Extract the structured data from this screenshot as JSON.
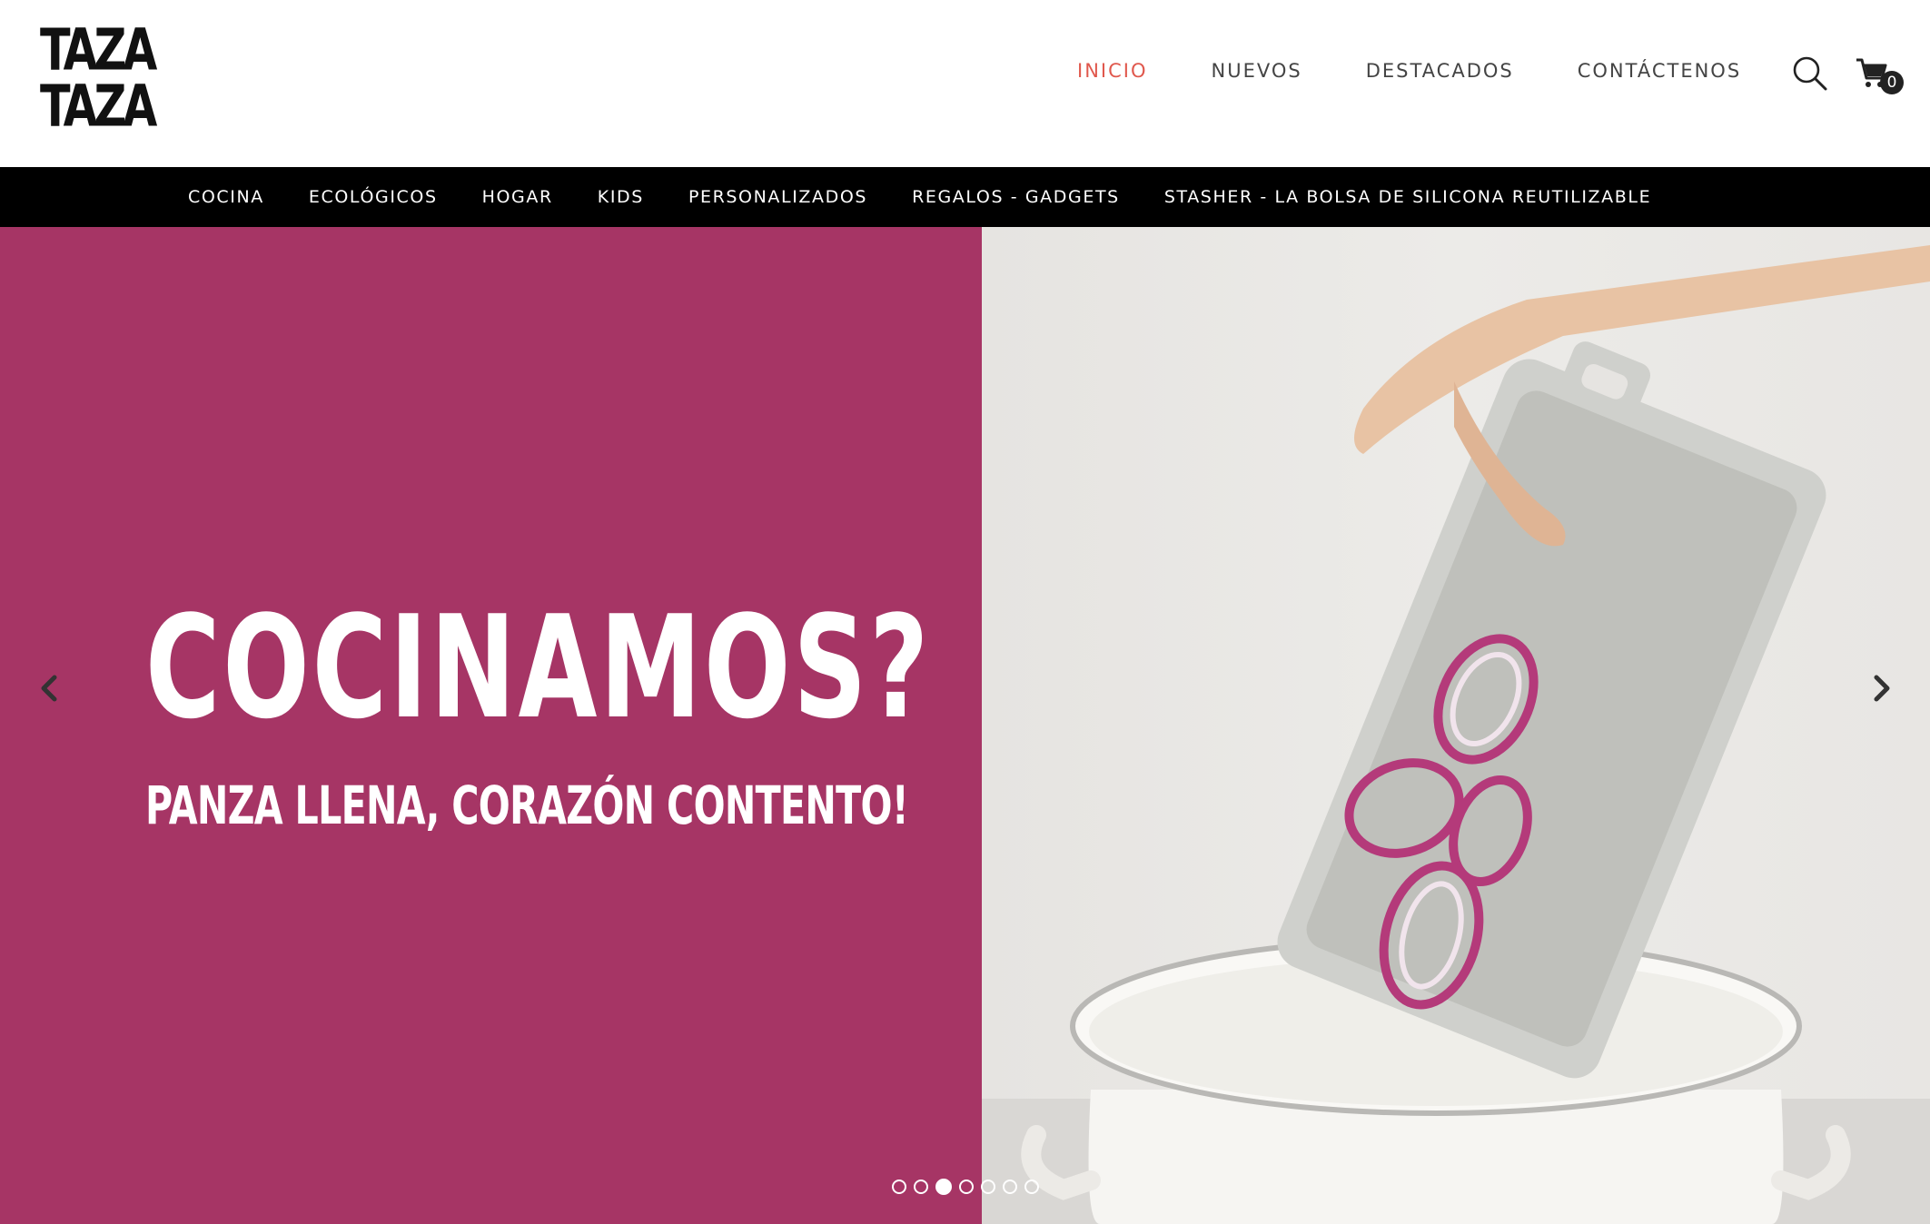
{
  "brand": {
    "logo_line1": "TAZA",
    "logo_line2": "TAZA"
  },
  "main_nav": {
    "items": [
      {
        "label": "INICIO",
        "active": true
      },
      {
        "label": "NUEVOS",
        "active": false
      },
      {
        "label": "DESTACADOS",
        "active": false
      },
      {
        "label": "CONTÁCTENOS",
        "active": false
      }
    ]
  },
  "cart": {
    "count": "0"
  },
  "categories": [
    "COCINA",
    "ECOLÓGICOS",
    "HOGAR",
    "KIDS",
    "PERSONALIZADOS",
    "REGALOS - GADGETS",
    "STASHER - LA BOLSA DE SILICONA REUTILIZABLE"
  ],
  "hero": {
    "headline": "COCINAMOS?",
    "subline": "PANZA LLENA, CORAZÓN CONTENTO!",
    "slide_count": 7,
    "active_slide": 3
  },
  "colors": {
    "accent": "#e0584d",
    "hero_magenta": "#a63565",
    "category_bar": "#000000"
  },
  "icons": [
    "search-icon",
    "cart-icon",
    "chevron-left-icon",
    "chevron-right-icon"
  ]
}
